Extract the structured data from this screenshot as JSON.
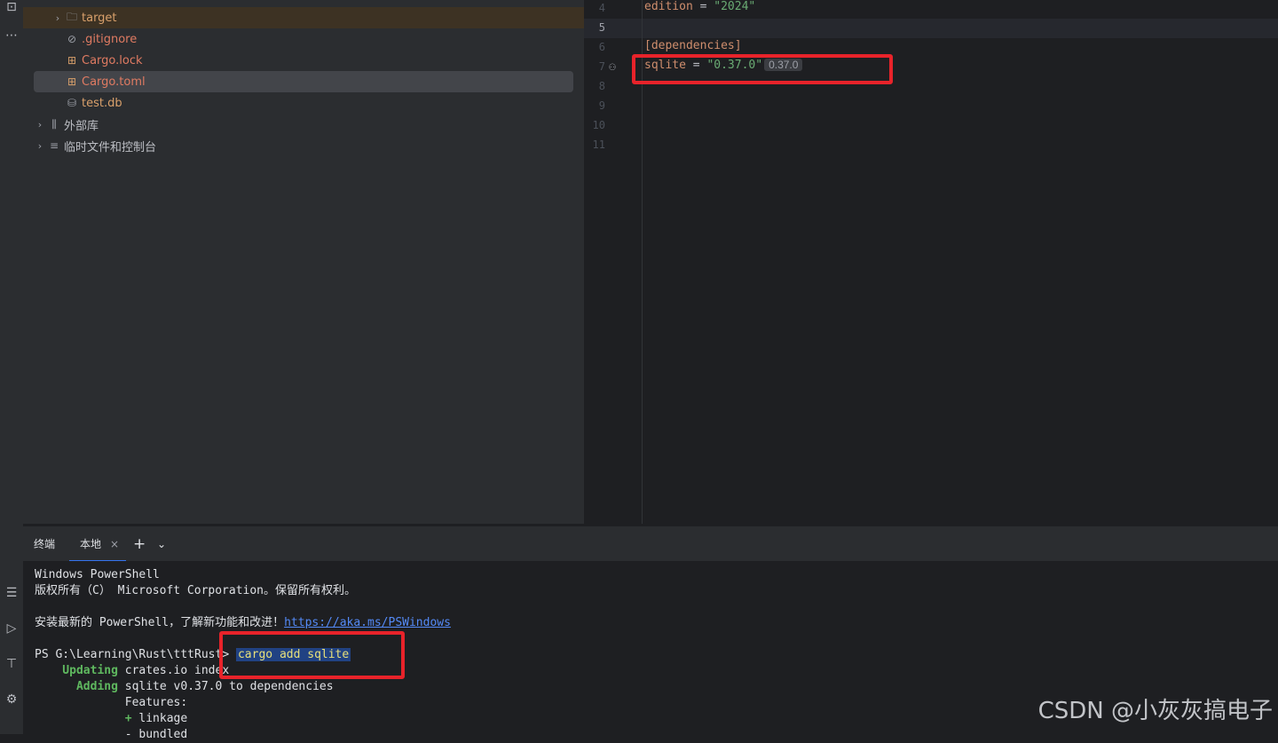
{
  "project_tree": {
    "items": [
      {
        "label": "target",
        "color": "orange",
        "icon": "folder-icon"
      },
      {
        "label": ".gitignore",
        "color": "red",
        "icon": "ignore-icon"
      },
      {
        "label": "Cargo.lock",
        "color": "red",
        "icon": "cargo-file-icon"
      },
      {
        "label": "Cargo.toml",
        "color": "red",
        "icon": "cargo-file-icon"
      },
      {
        "label": "test.db",
        "color": "orange",
        "icon": "database-icon"
      },
      {
        "label": "外部库",
        "color": "gray",
        "icon": "library-icon"
      },
      {
        "label": "临时文件和控制台",
        "color": "gray",
        "icon": "scratch-icon"
      }
    ]
  },
  "editor": {
    "line_numbers": [
      "4",
      "5",
      "6",
      "7",
      "8",
      "9",
      "10",
      "11"
    ],
    "edition_key": "edition",
    "edition_value": "\"2024\"",
    "section": "[dependencies]",
    "dep_key": "sqlite",
    "dep_value": "\"0.37.0\"",
    "dep_hint": "0.37.0",
    "equals": " = "
  },
  "terminal": {
    "title": "终端",
    "tab_label": "本地",
    "lines": {
      "l1": "Windows PowerShell",
      "l2": "版权所有（C） Microsoft Corporation。保留所有权利。",
      "l3_text": "安装最新的 PowerShell，了解新功能和改进！",
      "l3_link": "https://aka.ms/PSWindows",
      "prompt": "PS G:\\Learning\\Rust\\tttRust> ",
      "command": "cargo add sqlite",
      "updating_kw": "    Updating",
      "updating_rest": " crates.io index",
      "adding_kw": "      Adding",
      "adding_rest": " sqlite v0.37.0 to dependencies",
      "features": "             Features:",
      "plus": "             + ",
      "feature1": "linkage",
      "minus": "             - ",
      "feature2": "bundled"
    }
  },
  "watermark": "CSDN @小灰灰搞电子",
  "colors": {
    "highlight_box": "#e8232a",
    "accent": "#3574f0",
    "string": "#6aab73",
    "keyword": "#cf8e6d"
  }
}
